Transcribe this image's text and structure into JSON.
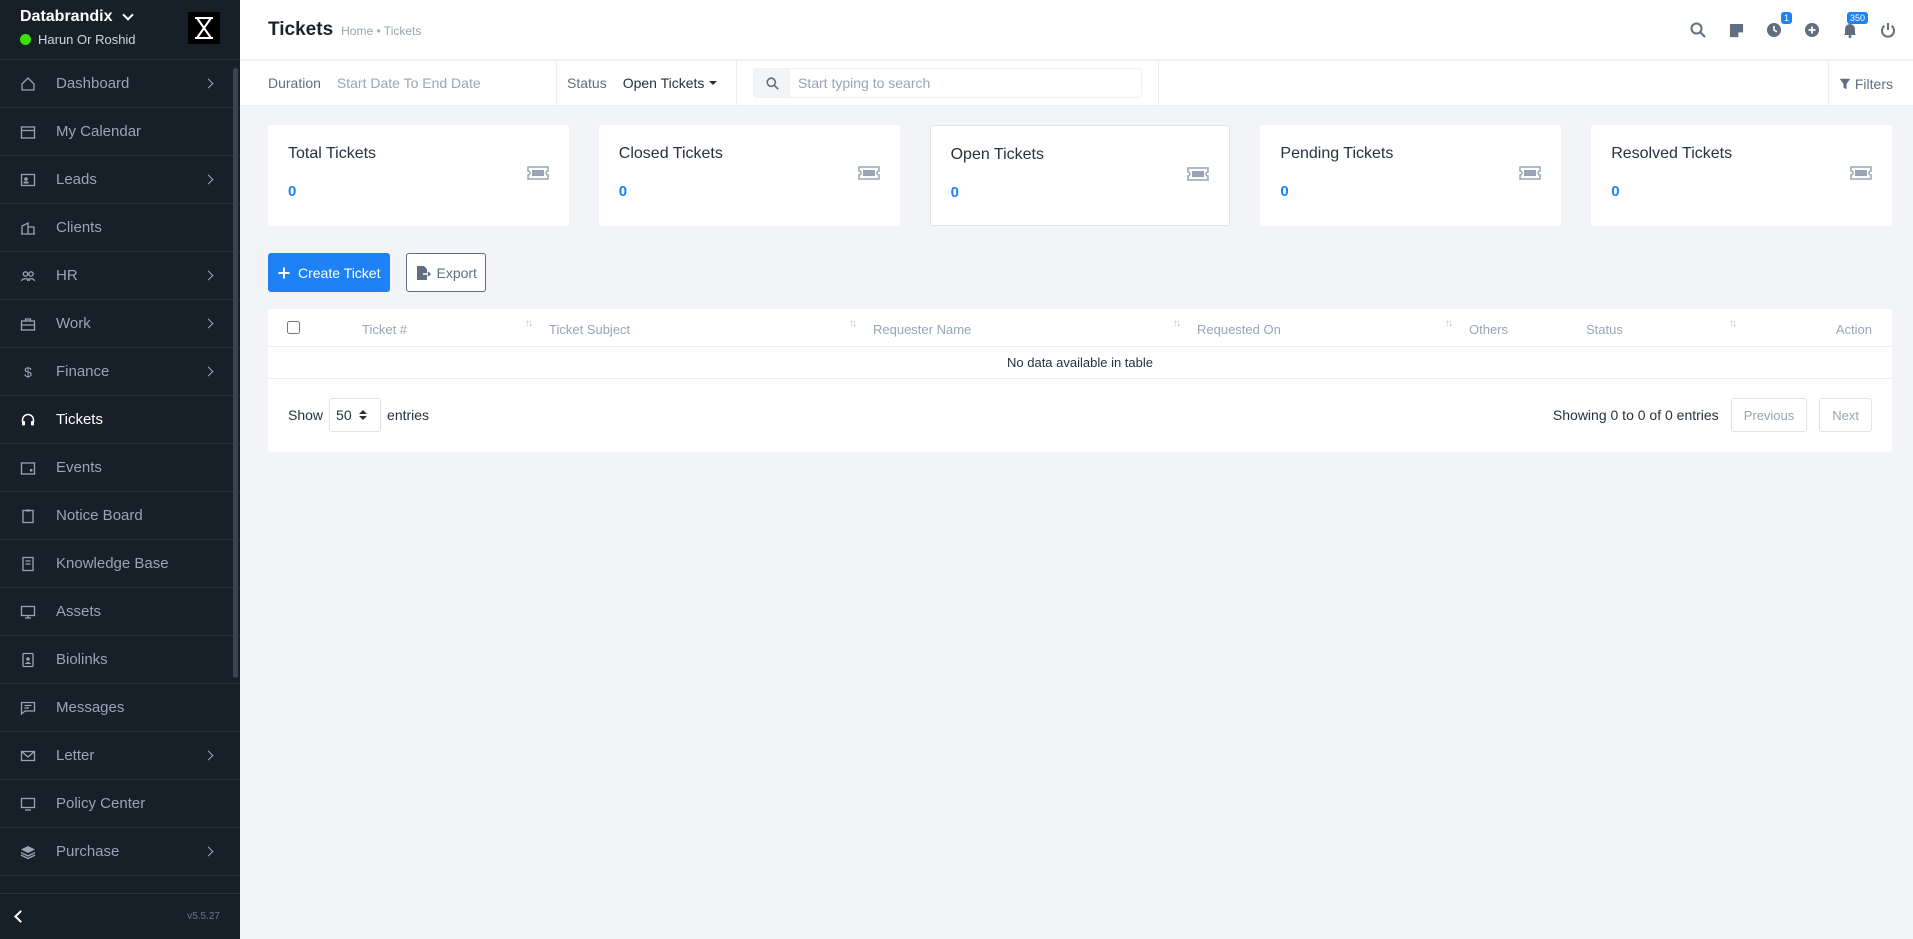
{
  "sidebar": {
    "company": "Databrandix",
    "user_name": "Harun Or Roshid",
    "version": "v5.5.27",
    "items": [
      {
        "label": "Dashboard",
        "icon": "house-icon"
      },
      {
        "label": "My Calendar",
        "icon": "calendar-icon"
      },
      {
        "label": "Leads",
        "icon": "person-card-icon"
      },
      {
        "label": "Clients",
        "icon": "building-icon"
      },
      {
        "label": "HR",
        "icon": "people-icon"
      },
      {
        "label": "Work",
        "icon": "briefcase-icon"
      },
      {
        "label": "Finance",
        "icon": "dollar-icon"
      },
      {
        "label": "Tickets",
        "icon": "headset-icon"
      },
      {
        "label": "Events",
        "icon": "calendar-event-icon"
      },
      {
        "label": "Notice Board",
        "icon": "clipboard-icon"
      },
      {
        "label": "Knowledge Base",
        "icon": "journal-icon"
      },
      {
        "label": "Assets",
        "icon": "display-icon"
      },
      {
        "label": "Biolinks",
        "icon": "person-badge-icon"
      },
      {
        "label": "Messages",
        "icon": "chat-icon"
      },
      {
        "label": "Letter",
        "icon": "envelope-icon"
      },
      {
        "label": "Policy Center",
        "icon": "monitor-icon"
      },
      {
        "label": "Purchase",
        "icon": "layers-icon"
      }
    ]
  },
  "header": {
    "title": "Tickets",
    "breadcrumb": "Home • Tickets",
    "timer_badge": "1",
    "notification_badge": "350"
  },
  "filters": {
    "duration_label": "Duration",
    "duration_value": "Start Date To End Date",
    "status_label": "Status",
    "status_value": "Open Tickets",
    "search_placeholder": "Start typing to search",
    "filters_label": "Filters"
  },
  "cards": [
    {
      "title": "Total Tickets",
      "value": "0"
    },
    {
      "title": "Closed Tickets",
      "value": "0"
    },
    {
      "title": "Open Tickets",
      "value": "0"
    },
    {
      "title": "Pending Tickets",
      "value": "0"
    },
    {
      "title": "Resolved Tickets",
      "value": "0"
    }
  ],
  "actions": {
    "create": "Create Ticket",
    "export": "Export"
  },
  "table": {
    "columns": [
      "Ticket #",
      "Ticket Subject",
      "Requester Name",
      "Requested On",
      "Others",
      "Status",
      "Action"
    ],
    "empty": "No data available in table",
    "show_label": "Show",
    "page_size": "50",
    "entries_label": "entries",
    "info": "Showing 0 to 0 of 0 entries",
    "previous": "Previous",
    "next": "Next"
  },
  "colors": {
    "sidebar_bg": "#171f29",
    "accent": "#1d82f5",
    "online": "#39e500"
  }
}
